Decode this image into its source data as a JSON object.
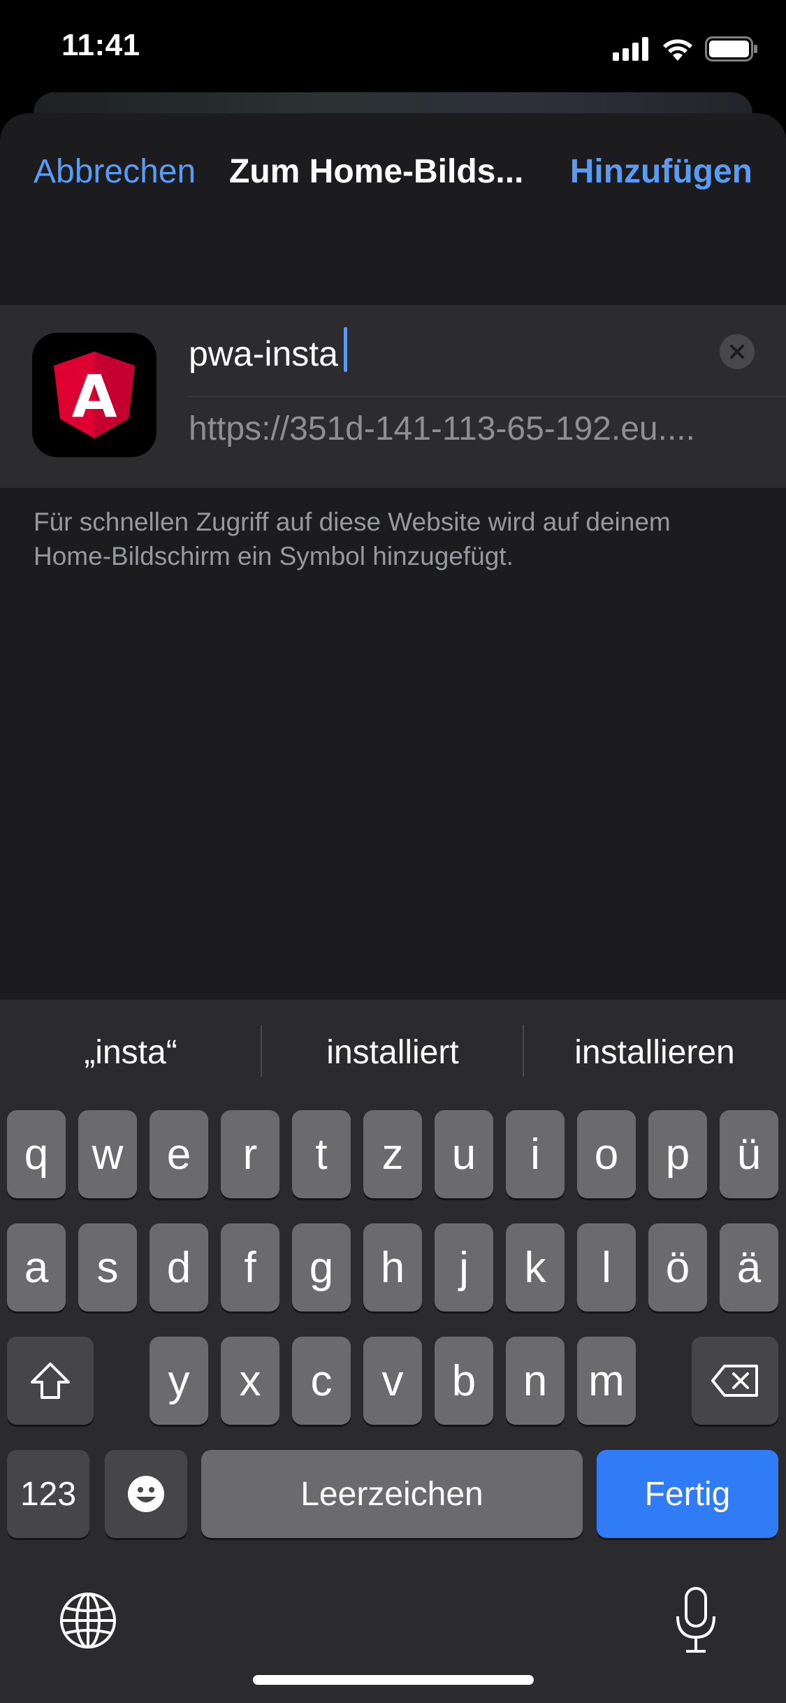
{
  "status_bar": {
    "time": "11:41"
  },
  "sheet": {
    "cancel_label": "Abbrechen",
    "title": "Zum Home-Bilds...",
    "add_label": "Hinzufügen",
    "name_value": "pwa-insta",
    "url": "https://351d-141-113-65-192.eu....",
    "description": "Für schnellen Zugriff auf diese Website wird auf deinem Home-Bildschirm ein Symbol hinzugefügt.",
    "icon_letter": "A"
  },
  "keyboard": {
    "suggestions": [
      "„insta“",
      "installiert",
      "installieren"
    ],
    "row1": [
      "q",
      "w",
      "e",
      "r",
      "t",
      "z",
      "u",
      "i",
      "o",
      "p",
      "ü"
    ],
    "row2": [
      "a",
      "s",
      "d",
      "f",
      "g",
      "h",
      "j",
      "k",
      "l",
      "ö",
      "ä"
    ],
    "row3": [
      "y",
      "x",
      "c",
      "v",
      "b",
      "n",
      "m"
    ],
    "numbers_label": "123",
    "space_label": "Leerzeichen",
    "done_label": "Fertig"
  },
  "colors": {
    "accent": "#5a9bf6",
    "done_key": "#2f7cf6",
    "angular_red": "#dd0031"
  }
}
